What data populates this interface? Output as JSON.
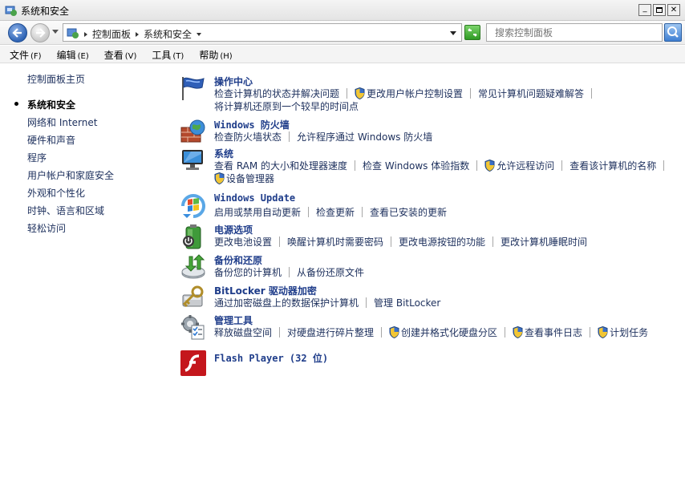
{
  "window": {
    "title": "系统和安全"
  },
  "address": {
    "crumbs": [
      "控制面板",
      "系统和安全"
    ]
  },
  "search": {
    "placeholder": "搜索控制面板"
  },
  "menu": [
    {
      "label": "文件",
      "accel": "(F)"
    },
    {
      "label": "编辑",
      "accel": "(E)"
    },
    {
      "label": "查看",
      "accel": "(V)"
    },
    {
      "label": "工具",
      "accel": "(T)"
    },
    {
      "label": "帮助",
      "accel": "(H)"
    }
  ],
  "leftnav": {
    "home": "控制面板主页",
    "items": [
      "系统和安全",
      "网络和 Internet",
      "硬件和声音",
      "程序",
      "用户帐户和家庭安全",
      "外观和个性化",
      "时钟、语言和区域",
      "轻松访问"
    ]
  },
  "categories": {
    "action_center": {
      "title": "操作中心",
      "links": [
        "检查计算机的状态并解决问题",
        "更改用户帐户控制设置",
        "常见计算机问题疑难解答",
        "将计算机还原到一个较早的时间点"
      ]
    },
    "firewall": {
      "title": "Windows 防火墙",
      "links": [
        "检查防火墙状态",
        "允许程序通过 Windows 防火墙"
      ]
    },
    "system": {
      "title": "系统",
      "links": [
        "查看 RAM 的大小和处理器速度",
        "检查 Windows 体验指数",
        "允许远程访问",
        "查看该计算机的名称",
        "设备管理器"
      ]
    },
    "windows_update": {
      "title": "Windows Update",
      "links": [
        "启用或禁用自动更新",
        "检查更新",
        "查看已安装的更新"
      ]
    },
    "power": {
      "title": "电源选项",
      "links": [
        "更改电池设置",
        "唤醒计算机时需要密码",
        "更改电源按钮的功能",
        "更改计算机睡眠时间"
      ]
    },
    "backup": {
      "title": "备份和还原",
      "links": [
        "备份您的计算机",
        "从备份还原文件"
      ]
    },
    "bitlocker": {
      "title": "BitLocker 驱动器加密",
      "links": [
        "通过加密磁盘上的数据保护计算机",
        "管理 BitLocker"
      ]
    },
    "admin_tools": {
      "title": "管理工具",
      "links": [
        "释放磁盘空间",
        "对硬盘进行碎片整理",
        "创建并格式化硬盘分区",
        "查看事件日志",
        "计划任务"
      ]
    },
    "flash": {
      "title": "Flash Player (32 位)"
    }
  },
  "colors": {
    "link": "#1c2f5c",
    "title": "#1f3d8a"
  },
  "icons": [
    "control-panel-icon",
    "back-arrow-icon",
    "forward-arrow-icon",
    "refresh-icon",
    "search-icon",
    "uac-shield-icon",
    "action-center-flag-icon",
    "firewall-icon",
    "system-computer-icon",
    "windows-update-icon",
    "power-battery-icon",
    "backup-restore-icon",
    "bitlocker-key-icon",
    "admin-tools-icon",
    "flash-player-icon"
  ]
}
